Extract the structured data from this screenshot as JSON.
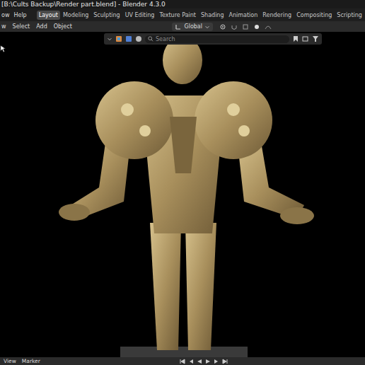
{
  "window": {
    "title": "[B:\\Cults Backup\\Render part.blend] - Blender 4.3.0"
  },
  "menu": [
    "ow",
    "Help"
  ],
  "workspaces": [
    {
      "label": "Layout",
      "selected": true
    },
    {
      "label": "Modeling",
      "selected": false
    },
    {
      "label": "Sculpting",
      "selected": false
    },
    {
      "label": "UV Editing",
      "selected": false
    },
    {
      "label": "Texture Paint",
      "selected": false
    },
    {
      "label": "Shading",
      "selected": false
    },
    {
      "label": "Animation",
      "selected": false
    },
    {
      "label": "Rendering",
      "selected": false
    },
    {
      "label": "Compositing",
      "selected": false
    },
    {
      "label": "Scripting",
      "selected": false
    }
  ],
  "add_workspace": "+",
  "header_menu": [
    "w",
    "Select",
    "Add",
    "Object"
  ],
  "transform_orientation": "Global",
  "search": {
    "placeholder": "Search"
  },
  "timeline": {
    "menu": [
      "View",
      "Marker"
    ]
  }
}
